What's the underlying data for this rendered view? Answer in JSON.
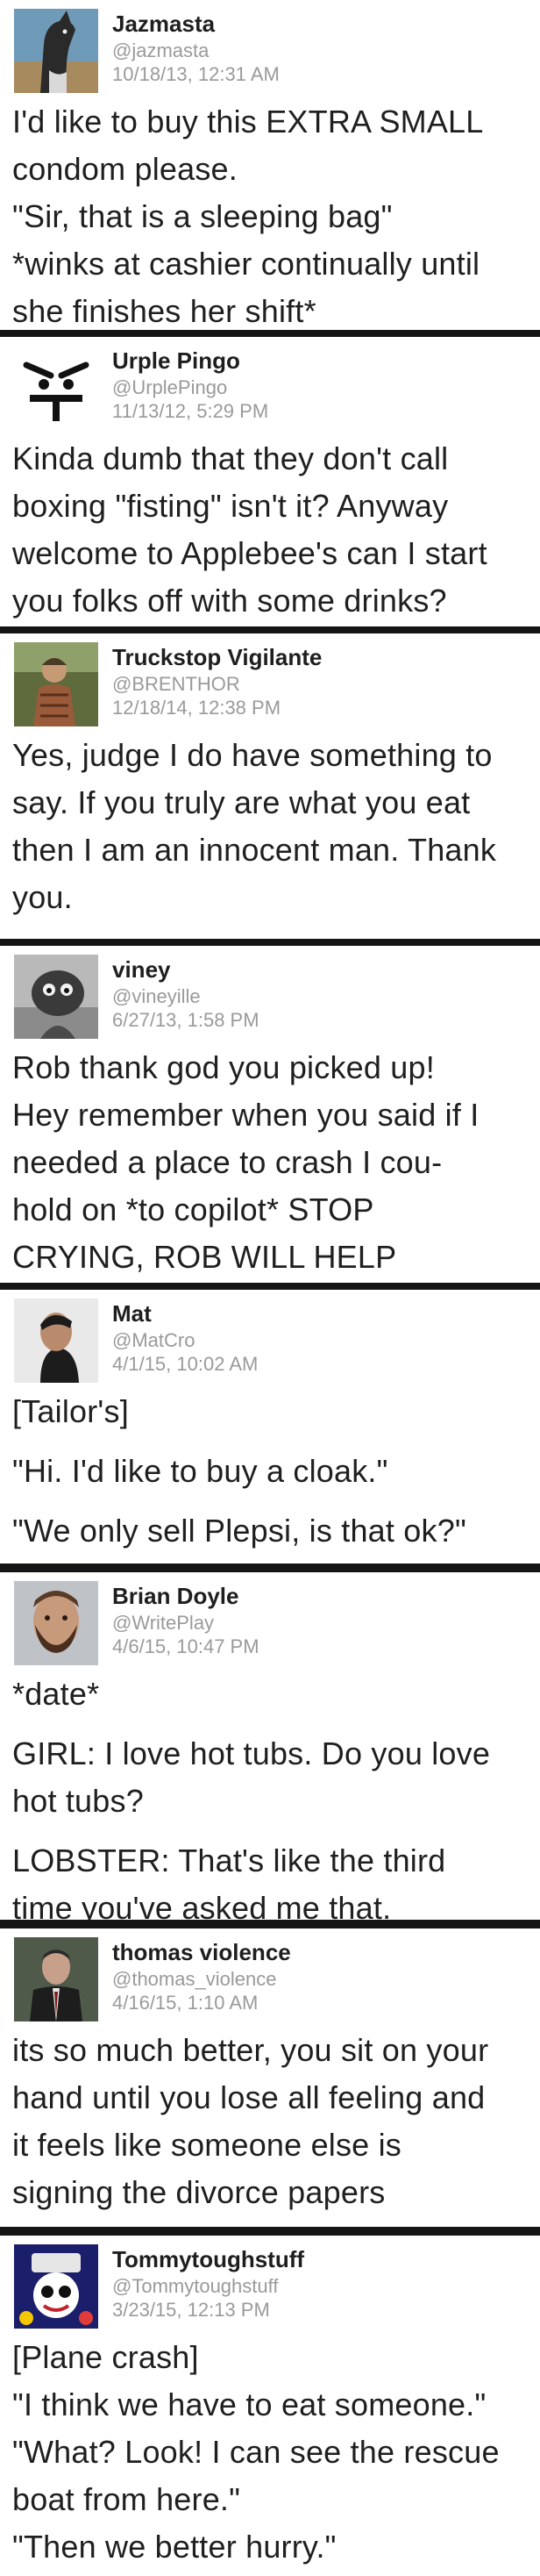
{
  "tweets": [
    {
      "name": "Jazmasta",
      "handle": "@jazmasta",
      "date": "10/18/13, 12:31 AM",
      "avatar": "greyhound-dog-avatar",
      "lines": [
        "I'd like to buy this EXTRA SMALL",
        "condom please.",
        "\"Sir, that is a sleeping bag\"",
        "*winks at cashier continually until",
        "she finishes her shift*"
      ]
    },
    {
      "name": "Urple Pingo",
      "handle": "@UrplePingo",
      "date": "11/13/12, 5:29 PM",
      "avatar": "angry-face-avatar",
      "lines": [
        "Kinda dumb that they don't call",
        "boxing \"fisting\" isn't it? Anyway",
        "welcome to Applebee's can I start",
        "you folks off with some drinks?"
      ]
    },
    {
      "name": "Truckstop Vigilante",
      "handle": "@BRENTHOR",
      "date": "12/18/14, 12:38 PM",
      "avatar": "man-outdoors-avatar",
      "lines": [
        "Yes, judge I do have something to",
        "say. If you truly are what you eat",
        "then I am an innocent man. Thank",
        "you."
      ]
    },
    {
      "name": "viney",
      "handle": "@vineyille",
      "date": "6/27/13, 1:58 PM",
      "avatar": "creature-avatar",
      "lines": [
        "Rob thank god you picked up!",
        "Hey remember when you said if I",
        "needed a place to crash I cou-",
        "hold on *to copilot* STOP",
        "CRYING, ROB WILL HELP"
      ]
    },
    {
      "name": "Mat",
      "handle": "@MatCro",
      "date": "4/1/15, 10:02 AM",
      "avatar": "man-profile-avatar",
      "lines": [
        "[Tailor's]",
        "",
        "\"Hi. I'd like to buy a cloak.\"",
        "",
        "\"We only sell Plepsi, is that ok?\""
      ]
    },
    {
      "name": "Brian Doyle",
      "handle": "@WritePlay",
      "date": "4/6/15, 10:47 PM",
      "avatar": "bearded-man-avatar",
      "lines": [
        "*date*",
        "",
        "GIRL: I love hot tubs. Do you love",
        "hot tubs?",
        "",
        "LOBSTER: That's like the third",
        "time you've asked me that."
      ]
    },
    {
      "name": "thomas violence",
      "handle": "@thomas_violence",
      "date": "4/16/15, 1:10 AM",
      "avatar": "man-in-suit-avatar",
      "lines": [
        "its so much better, you sit on your",
        "hand until you lose all feeling and",
        "it feels like someone else is",
        "signing the divorce papers"
      ]
    },
    {
      "name": "Tommytoughstuff",
      "handle": "@Tommytoughstuff",
      "date": "3/23/15, 12:13 PM",
      "avatar": "cartoon-logo-avatar",
      "lines": [
        "[Plane crash]",
        "\"I think we have to eat someone.\"",
        "\"What? Look! I can see the rescue",
        "boat from here.\"",
        "\"Then we better hurry.\""
      ]
    }
  ]
}
